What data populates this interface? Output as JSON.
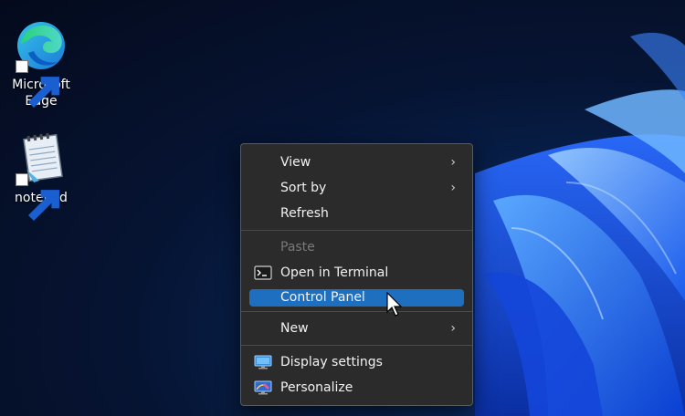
{
  "desktop": {
    "icons": [
      {
        "label_line1": "Microsoft",
        "label_line2": "Edge",
        "icon": "edge-icon"
      },
      {
        "label_line1": "notepad",
        "label_line2": "",
        "icon": "notepad-icon"
      }
    ]
  },
  "context_menu": {
    "items": [
      {
        "label": "View",
        "submenu": true
      },
      {
        "label": "Sort by",
        "submenu": true
      },
      {
        "label": "Refresh"
      },
      {
        "label": "Paste",
        "disabled": true
      },
      {
        "label": "Open in Terminal",
        "icon": "terminal-icon"
      },
      {
        "label": "Control Panel",
        "highlighted": true
      },
      {
        "label": "New",
        "submenu": true
      },
      {
        "label": "Display settings",
        "icon": "display-settings-icon"
      },
      {
        "label": "Personalize",
        "icon": "personalize-icon"
      }
    ],
    "submenu_glyph": "›"
  },
  "colors": {
    "menu_bg": "#2b2b2b",
    "highlight": "#1e6fbf",
    "accent_blue": "#1f66ff"
  }
}
